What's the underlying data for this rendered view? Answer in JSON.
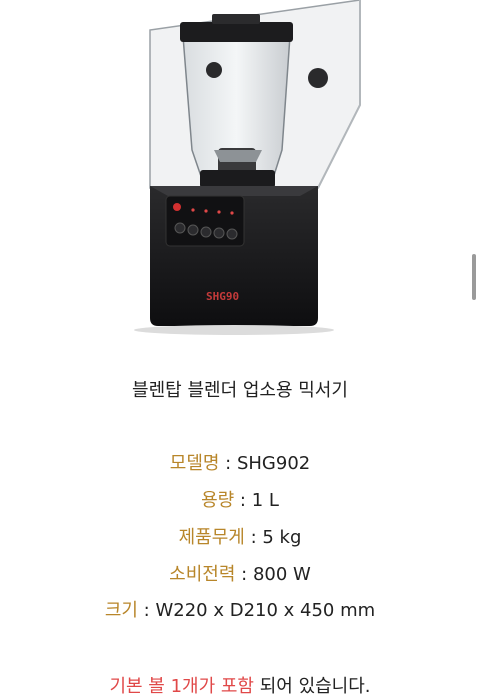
{
  "product": {
    "brand_mark": "SHG90",
    "caption": "블렌탑 블렌더 업소용 믹서기"
  },
  "specs": [
    {
      "label": "모델명",
      "sep": " : ",
      "value": "SHG902"
    },
    {
      "label": "용량",
      "sep": " : ",
      "value": "1 L"
    },
    {
      "label": "제품무게",
      "sep": " : ",
      "value": "5 kg"
    },
    {
      "label": "소비전력",
      "sep": " : ",
      "value": "800 W"
    },
    {
      "label": "크기",
      "sep": " : ",
      "value": "W220 x D210 x 450 mm"
    }
  ],
  "note": {
    "highlight": "기본 볼 1개가 포함",
    "rest": " 되어 있습니다."
  },
  "colors": {
    "label": "#b8862a",
    "highlight": "#e04848",
    "text": "#222222"
  },
  "scrollbar": {
    "position_fraction": 0.36
  }
}
